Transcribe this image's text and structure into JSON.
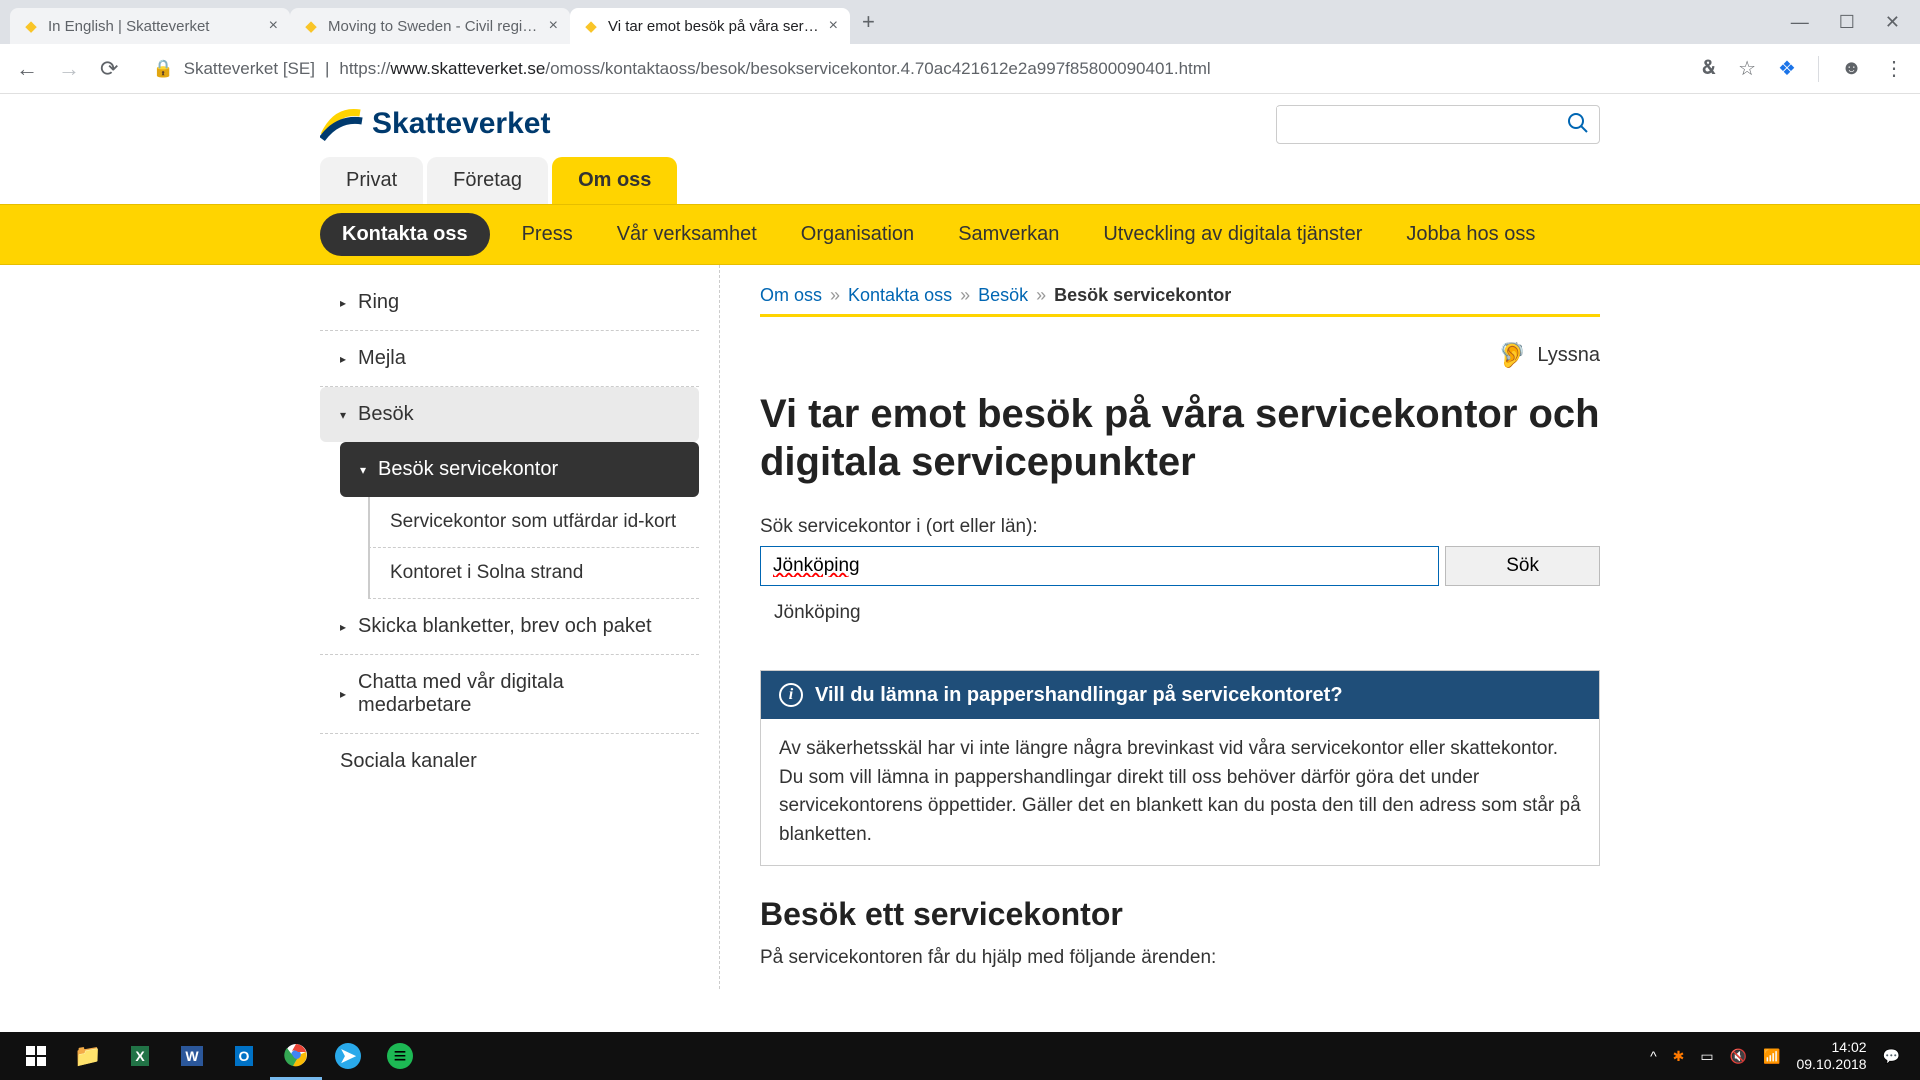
{
  "browser": {
    "tabs": [
      {
        "title": "In English | Skatteverket"
      },
      {
        "title": "Moving to Sweden - Civil registra"
      },
      {
        "title": "Vi tar emot besök på våra service"
      }
    ],
    "address": {
      "owner": "Skatteverket [SE]",
      "url_prefix": "https://",
      "url_domain": "www.skatteverket.se",
      "url_path": "/omoss/kontaktaoss/besok/besokservicekontor.4.70ac421612e2a997f85800090401.html"
    }
  },
  "site": {
    "logo_text": "Skatteverket",
    "top_tabs": {
      "privat": "Privat",
      "foretag": "Företag",
      "omoss": "Om oss"
    },
    "yellow_nav": {
      "kontakta": "Kontakta oss",
      "press": "Press",
      "verksamhet": "Vår verksamhet",
      "organisation": "Organisation",
      "samverkan": "Samverkan",
      "utveckling": "Utveckling av digitala tjänster",
      "jobba": "Jobba hos oss"
    }
  },
  "sidebar": {
    "ring": "Ring",
    "mejla": "Mejla",
    "besok": "Besök",
    "besok_service": "Besök servicekontor",
    "id_kort": "Servicekontor som utfärdar id-kort",
    "solna": "Kontoret i Solna strand",
    "skicka": "Skicka blanketter, brev och paket",
    "chatta": "Chatta med vår digitala medarbetare",
    "sociala": "Sociala kanaler"
  },
  "main": {
    "breadcrumb": {
      "omoss": "Om oss",
      "kontakta": "Kontakta oss",
      "besok": "Besök",
      "current": "Besök servicekontor"
    },
    "listen": "Lyssna",
    "h1": "Vi tar emot besök på våra servicekontor och digitala servicepunkter",
    "search_label": "Sök servicekontor i (ort eller län):",
    "search_value": "Jönköping",
    "search_button": "Sök",
    "suggestion": "Jönköping",
    "info_title": "Vill du lämna in pappershandlingar på servicekontoret?",
    "info_body": "Av säkerhetsskäl har vi inte längre några brevinkast vid våra servicekontor eller skattekontor. Du som vill lämna in pappershandlingar direkt till oss behöver därför göra det under servicekontorens öppettider. Gäller det en blankett kan du posta den till den adress som står på blanketten.",
    "h2": "Besök ett servicekontor",
    "body_text": "På servicekontoren får du hjälp med följande ärenden:"
  },
  "taskbar": {
    "time": "14:02",
    "date": "09.10.2018"
  }
}
